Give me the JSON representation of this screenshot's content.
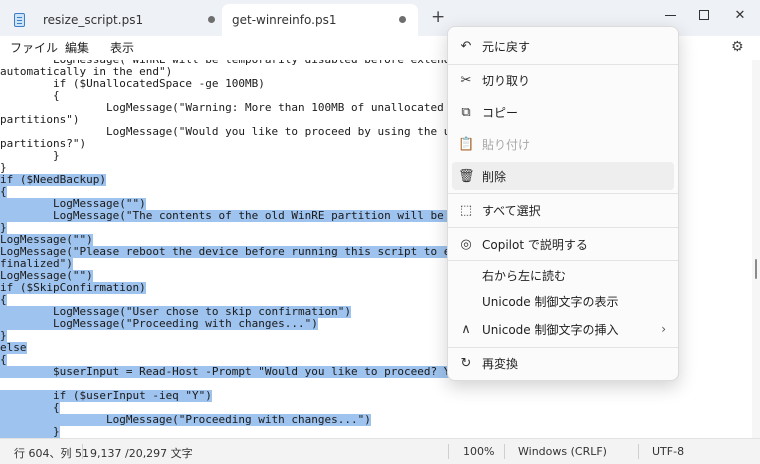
{
  "tabs": [
    {
      "label": "resize_script.ps1",
      "active": false
    },
    {
      "label": "get-winreinfo.ps1",
      "active": true
    }
  ],
  "new_tab_label": "+",
  "menubar": {
    "file": "ファイル",
    "edit": "編集",
    "view": "表示"
  },
  "editor": {
    "lines": [
      {
        "text": "        LogMessage(\"WinRE will be temporarily disabled before extending",
        "selected": false
      },
      {
        "text": "automatically in the end\")",
        "selected": false
      },
      {
        "text": "        if ($UnallocatedSpace -ge 100MB)",
        "selected": false
      },
      {
        "text": "        {",
        "selected": false
      },
      {
        "text": "                LogMessage(\"Warning: More than 100MB of unallocated                         d WinRE",
        "selected": false
      },
      {
        "text": "partitions\")",
        "selected": false
      },
      {
        "text": "                LogMessage(\"Would you like to proceed by using the u                        the WinRE",
        "selected": false
      },
      {
        "text": "partitions?\")",
        "selected": false
      },
      {
        "text": "        }",
        "selected": false
      },
      {
        "text": "}",
        "selected": false
      },
      {
        "text": "if ($NeedBackup)",
        "selected": true
      },
      {
        "text": "{",
        "selected": true
      },
      {
        "text": "        LogMessage(\"\")",
        "selected": true
      },
      {
        "text": "        LogMessage(\"The contents of the old WinRE partition will be                        \")",
        "selected": true
      },
      {
        "text": "}",
        "selected": true
      },
      {
        "text": "LogMessage(\"\")",
        "selected": true
      },
      {
        "text": "LogMessage(\"Please reboot the device before running this script to e                      are",
        "selected": true
      },
      {
        "text": "finalized\")",
        "selected": true
      },
      {
        "text": "LogMessage(\"\")",
        "selected": true
      },
      {
        "text": "if ($SkipConfirmation)",
        "selected": true
      },
      {
        "text": "{",
        "selected": true
      },
      {
        "text": "        LogMessage(\"User chose to skip confirmation\")",
        "selected": true
      },
      {
        "text": "        LogMessage(\"Proceeding with changes...\")",
        "selected": true
      },
      {
        "text": "}",
        "selected": true
      },
      {
        "text": "else",
        "selected": true
      },
      {
        "text": "{",
        "selected": true
      },
      {
        "text": "        $userInput = Read-Host -Prompt \"Would you like to proceed? Y",
        "selected": true
      },
      {
        "text": "",
        "selected": true
      },
      {
        "text": "        if ($userInput -ieq \"Y\")",
        "selected": true
      },
      {
        "text": "        {",
        "selected": true
      },
      {
        "text": "                LogMessage(\"Proceeding with changes...\")",
        "selected": true
      },
      {
        "text": "        }",
        "selected": true
      },
      {
        "text": "        else",
        "selected": true
      }
    ]
  },
  "context_menu": {
    "items": [
      {
        "label": "元に戻す",
        "icon": "undo-icon",
        "glyph": "↶",
        "disabled": false
      },
      {
        "label": "切り取り",
        "icon": "scissors-icon",
        "glyph": "✂",
        "disabled": false
      },
      {
        "label": "コピー",
        "icon": "copy-icon",
        "glyph": "⧉",
        "disabled": false
      },
      {
        "label": "貼り付け",
        "icon": "paste-icon",
        "glyph": "📋",
        "disabled": true
      },
      {
        "label": "削除",
        "icon": "trash-icon",
        "glyph": "🗑",
        "disabled": false
      },
      {
        "label": "すべて選択",
        "icon": "select-all-icon",
        "glyph": "⬚",
        "disabled": false
      },
      {
        "label": "Copilot で説明する",
        "icon": "copilot-icon",
        "glyph": "◎",
        "disabled": false
      },
      {
        "label": "右から左に読む",
        "icon": "",
        "glyph": "",
        "disabled": false
      },
      {
        "label": "Unicode 制御文字の表示",
        "icon": "",
        "glyph": "",
        "disabled": false
      },
      {
        "label": "Unicode 制御文字の挿入",
        "icon": "insert-caret-icon",
        "glyph": "∧",
        "disabled": false
      },
      {
        "label": "再変換",
        "icon": "reconvert-icon",
        "glyph": "↻",
        "disabled": false
      }
    ]
  },
  "status": {
    "position": "行 604、列 51",
    "count": "9,137 /20,297 文字",
    "zoom": "100%",
    "eol": "Windows (CRLF)",
    "encoding": "UTF-8"
  },
  "colors": {
    "selection": "#9ec3ee",
    "tabbar": "#eef1f6"
  }
}
